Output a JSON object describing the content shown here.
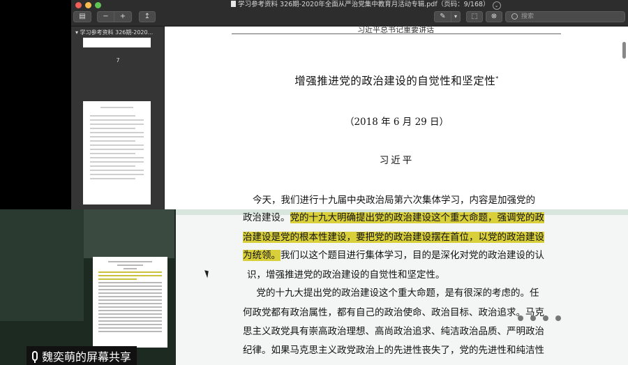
{
  "window": {
    "title": "学习参考资料 326期-2020年全面从严治党集中教育月活动专辑.pdf（页码：9/168）",
    "title_chevron": "⌄",
    "search_placeholder": "搜索"
  },
  "toolbar": {
    "sidebar_toggle": "▤",
    "zoom_out": "−",
    "zoom_in": "+",
    "share": "↥",
    "markup": "✎",
    "markup_dropdown": "▾",
    "rotate": "⬚",
    "annotate": "⊗"
  },
  "sidebar": {
    "title": "▾ 学习参考资料 326期-2020...",
    "page_number": "7"
  },
  "document": {
    "running_head": "习近平总书记重要讲话",
    "title": "增强推进党的政治建设的自觉性和坚定性",
    "title_mark": "*",
    "date": "（2018 年 6 月 29 日）",
    "author": "习近平",
    "para1_line1": "今天，我们进行十九届中央政治局第六次集体学习，内容是加强党的",
    "lines": [
      {
        "pre": "政治建设。",
        "hl": "党的十九大明确提出党的政治建设这个重大命题，强调党的政",
        "post": ""
      },
      {
        "pre": "",
        "hl": "治建设是党的根本性建设，要把党的政治建设摆在首位，以党的政治建设",
        "post": ""
      },
      {
        "pre": "",
        "hl": "为统领。",
        "post": "我们以这个题目进行集体学习，目的是深化对党的政治建设的认"
      },
      {
        "pre": "识，增强推进党的政治建设的自觉性和坚定性。",
        "hl": "",
        "post": ""
      },
      {
        "pre": "　党的十九大提出党的政治建设这个重大命题，是有很深的考虑的。任",
        "hl": "",
        "post": ""
      },
      {
        "pre": "何政党都有政治属性，都有自己的政治使命、政治目标、政治追求。马克",
        "hl": "",
        "post": ""
      },
      {
        "pre": "思主义政党具有崇高政治理想、高尚政治追求、纯洁政治品质、严明政治",
        "hl": "",
        "post": ""
      },
      {
        "pre": "纪律。如果马克思主义政党政治上的先进性丧失了，党的先进性和纯洁性",
        "hl": "",
        "post": ""
      }
    ]
  },
  "share_bar": {
    "label": "魏奕萌的屏幕共享"
  },
  "colors": {
    "highlight": "#d8cf3a",
    "titlebar": "#2d2d2d",
    "sidebar": "#353535"
  }
}
